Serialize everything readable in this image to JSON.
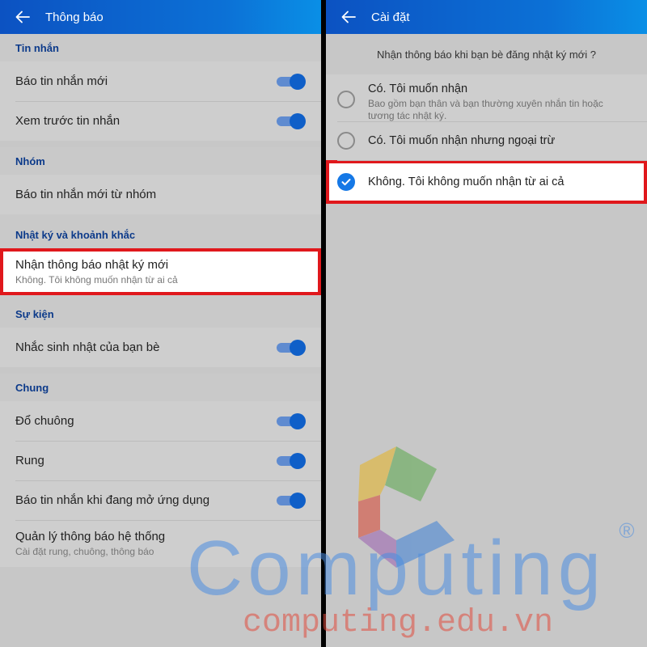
{
  "left": {
    "title": "Thông báo",
    "sections": [
      {
        "header": "Tin nhắn",
        "rows": [
          {
            "title": "Báo tin nhắn mới",
            "toggle": true
          },
          {
            "title": "Xem trước tin nhắn",
            "toggle": true
          }
        ]
      },
      {
        "header": "Nhóm",
        "rows": [
          {
            "title": "Báo tin nhắn mới từ nhóm"
          }
        ]
      },
      {
        "header": "Nhật ký và khoảnh khắc",
        "rows": [
          {
            "title": "Nhận thông báo nhật ký mới",
            "subtitle": "Không. Tôi không muốn nhận từ ai cả",
            "highlighted": true
          }
        ]
      },
      {
        "header": "Sự kiện",
        "rows": [
          {
            "title": "Nhắc sinh nhật của bạn bè",
            "toggle": true
          }
        ]
      },
      {
        "header": "Chung",
        "rows": [
          {
            "title": "Đổ chuông",
            "toggle": true
          },
          {
            "title": "Rung",
            "toggle": true
          },
          {
            "title": "Báo tin nhắn khi đang mở ứng dụng",
            "toggle": true
          },
          {
            "title": "Quản lý thông báo hệ thống",
            "subtitle": "Cài đặt rung, chuông, thông báo"
          }
        ]
      }
    ]
  },
  "right": {
    "title": "Cài đặt",
    "question": "Nhận thông báo khi bạn bè đăng nhật ký mới ?",
    "options": [
      {
        "title": "Có. Tôi muốn nhận",
        "subtitle": "Bao gồm bạn thân và bạn thường xuyên nhắn tin hoặc tương tác nhật ký.",
        "checked": false
      },
      {
        "title": "Có. Tôi muốn nhận nhưng ngoại trừ",
        "checked": false
      },
      {
        "title": "Không. Tôi không muốn nhận từ ai cả",
        "checked": true,
        "highlighted": true
      }
    ]
  },
  "watermark": {
    "brand": "Computing",
    "url": "computing.edu.vn",
    "registered": "®"
  },
  "colors": {
    "appbar": "#0c62cc",
    "highlight_border": "#e0181c",
    "toggle_on": "#0f5fc8",
    "section_header": "#0c3a8a"
  }
}
